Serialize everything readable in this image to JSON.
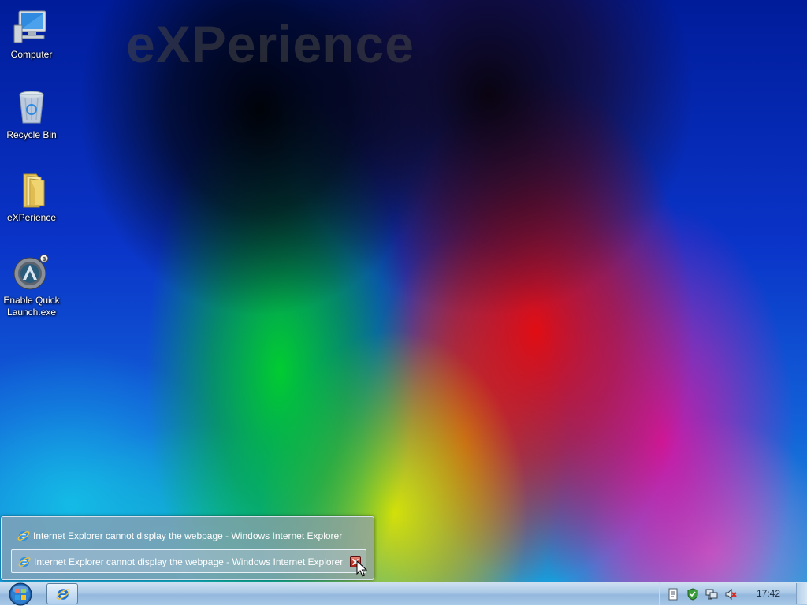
{
  "desktop": {
    "watermark": "eXPerience",
    "icons": [
      {
        "label": "Computer",
        "icon": "computer-icon"
      },
      {
        "label": "Recycle Bin",
        "icon": "recycle-bin-icon"
      },
      {
        "label": "eXPerience",
        "icon": "folder-icon"
      },
      {
        "label": "Enable Quick Launch.exe",
        "icon": "quick-launch-app-icon"
      }
    ]
  },
  "popup": {
    "items": [
      {
        "title": "Internet Explorer cannot display the webpage - Windows Internet Explorer",
        "icon": "internet-explorer-icon"
      },
      {
        "title": "Internet Explorer cannot display the webpage - Windows Internet Explorer",
        "icon": "internet-explorer-icon",
        "hovered": true,
        "close_icon": "close-icon"
      }
    ]
  },
  "taskbar": {
    "start_icon": "windows-orb-icon",
    "task_buttons": [
      {
        "app": "Windows Internet Explorer",
        "icon": "internet-explorer-icon",
        "active": true
      }
    ],
    "tray_icons": [
      "document-icon",
      "security-shield-icon",
      "network-icon",
      "volume-muted-icon"
    ],
    "clock": "17:42"
  },
  "colors": {
    "taskbar": "#a9c8e6",
    "close_button": "#c43b2a",
    "ie_blue": "#1a6fd0"
  }
}
